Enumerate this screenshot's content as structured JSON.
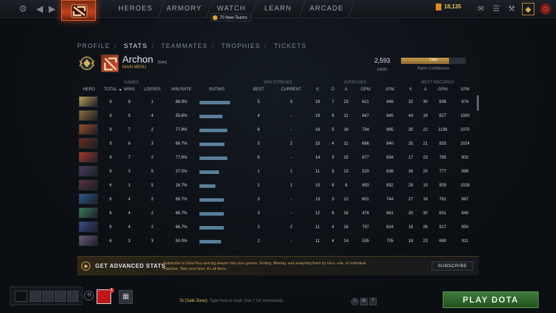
{
  "topnav": {
    "items": [
      "HEROES",
      "ARMORY",
      "WATCH",
      "LEARN",
      "ARCADE"
    ],
    "teams_badge": "70 New Teams",
    "shards": "18,135"
  },
  "subnav": {
    "items": [
      "PROFILE",
      "STATS",
      "TEAMMATES",
      "TROPHIES",
      "TICKETS"
    ],
    "separator": "/",
    "active": "STATS"
  },
  "profile": {
    "name": "Archon",
    "tag": "[Safe]",
    "subtitle": "MAIN MENU",
    "mmr_value": "2,593",
    "mmr_label": "MMR",
    "rank_confidence_value": "74%",
    "rank_confidence_fraction": 0.74,
    "rank_confidence_label": "Rank Confidence"
  },
  "table": {
    "groups": [
      "GAMES",
      "WIN STREAKS",
      "AVERAGES",
      "BEST RECORDS"
    ],
    "columns": [
      "HERO",
      "TOTAL",
      "WINS",
      "LOSSES",
      "WIN RATE",
      "RATING",
      "BEST",
      "CURRENT",
      "K",
      "D",
      "A",
      "GPM",
      "XPM",
      "K",
      "A",
      "GPM",
      "XPM"
    ],
    "sort_indicator": "▾",
    "rows": [
      {
        "hero_color": "#b59a52",
        "total": "9",
        "wins": "8",
        "losses": "1",
        "win_rate": "88.9%",
        "rating": 0.88,
        "best": "5",
        "current": "3",
        "k": "19",
        "d": "7",
        "a": "23",
        "gpm": "621",
        "xpm": "848",
        "bk": "32",
        "ba": "30",
        "bgpm": "836",
        "bxpm": "974"
      },
      {
        "hero_color": "#8a6a3a",
        "total": "9",
        "wins": "5",
        "losses": "4",
        "win_rate": "55.6%",
        "rating": 0.66,
        "best": "4",
        "current": "-",
        "k": "19",
        "d": "6",
        "a": "11",
        "gpm": "647",
        "xpm": "845",
        "bk": "44",
        "ba": "18",
        "bgpm": "827",
        "bxpm": "1000"
      },
      {
        "hero_color": "#9a4a2a",
        "total": "9",
        "wins": "7",
        "losses": "2",
        "win_rate": "77.8%",
        "rating": 0.8,
        "best": "6",
        "current": "-",
        "k": "16",
        "d": "5",
        "a": "16",
        "gpm": "734",
        "xpm": "895",
        "bk": "25",
        "ba": "22",
        "bgpm": "1136",
        "bxpm": "1070"
      },
      {
        "hero_color": "#6a2a1a",
        "total": "9",
        "wins": "6",
        "losses": "3",
        "win_rate": "66.7%",
        "rating": 0.72,
        "best": "3",
        "current": "2",
        "k": "15",
        "d": "4",
        "a": "11",
        "gpm": "666",
        "xpm": "840",
        "bk": "25",
        "ba": "21",
        "bgpm": "833",
        "bxpm": "1024"
      },
      {
        "hero_color": "#a8382a",
        "total": "9",
        "wins": "7",
        "losses": "2",
        "win_rate": "77.8%",
        "rating": 0.8,
        "best": "6",
        "current": "-",
        "k": "14",
        "d": "3",
        "a": "15",
        "gpm": "677",
        "xpm": "834",
        "bk": "17",
        "ba": "23",
        "bgpm": "765",
        "bxpm": "902"
      },
      {
        "hero_color": "#4a3a5a",
        "total": "8",
        "wins": "3",
        "losses": "5",
        "win_rate": "37.5%",
        "rating": 0.55,
        "best": "1",
        "current": "1",
        "k": "11",
        "d": "5",
        "a": "13",
        "gpm": "520",
        "xpm": "638",
        "bk": "26",
        "ba": "20",
        "bgpm": "777",
        "bxpm": "999"
      },
      {
        "hero_color": "#5a3040",
        "total": "6",
        "wins": "1",
        "losses": "5",
        "win_rate": "16.7%",
        "rating": 0.46,
        "best": "1",
        "current": "1",
        "k": "15",
        "d": "8",
        "a": "8",
        "gpm": "650",
        "xpm": "832",
        "bk": "28",
        "ba": "15",
        "bgpm": "909",
        "bxpm": "1028"
      },
      {
        "hero_color": "#2a5a8a",
        "total": "6",
        "wins": "4",
        "losses": "2",
        "win_rate": "66.7%",
        "rating": 0.7,
        "best": "3",
        "current": "-",
        "k": "13",
        "d": "3",
        "a": "12",
        "gpm": "601",
        "xpm": "744",
        "bk": "27",
        "ba": "18",
        "bgpm": "761",
        "bxpm": "987"
      },
      {
        "hero_color": "#3a7a5a",
        "total": "6",
        "wins": "4",
        "losses": "2",
        "win_rate": "66.7%",
        "rating": 0.7,
        "best": "3",
        "current": "-",
        "k": "12",
        "d": "6",
        "a": "16",
        "gpm": "476",
        "xpm": "661",
        "bk": "20",
        "ba": "30",
        "bgpm": "601",
        "bxpm": "846"
      },
      {
        "hero_color": "#3a4a8a",
        "total": "6",
        "wins": "4",
        "losses": "2",
        "win_rate": "66.7%",
        "rating": 0.7,
        "best": "2",
        "current": "2",
        "k": "11",
        "d": "4",
        "a": "16",
        "gpm": "797",
        "xpm": "824",
        "bk": "18",
        "ba": "26",
        "bgpm": "917",
        "bxpm": "950"
      },
      {
        "hero_color": "#6a5a7a",
        "total": "6",
        "wins": "3",
        "losses": "3",
        "win_rate": "50.0%",
        "rating": 0.62,
        "best": "2",
        "current": "-",
        "k": "11",
        "d": "4",
        "a": "14",
        "gpm": "535",
        "xpm": "705",
        "bk": "18",
        "ba": "23",
        "bgpm": "669",
        "bxpm": "911"
      }
    ]
  },
  "banner": {
    "title": "GET ADVANCED STATS",
    "description": "Subscribe to Dota Plus and dig deeper into your games. Sorting, filtering, and analyzing them by hero, role, or individual matches. Take your time; it's all there.",
    "button": "SUBSCRIBE"
  },
  "bottom": {
    "chat_to": "To (Safe`Zone):",
    "chat_placeholder": "Type here to chat. Use '/' for commands.",
    "notif_count": "1",
    "help": "?",
    "play_label": "PLAY DOTA"
  }
}
